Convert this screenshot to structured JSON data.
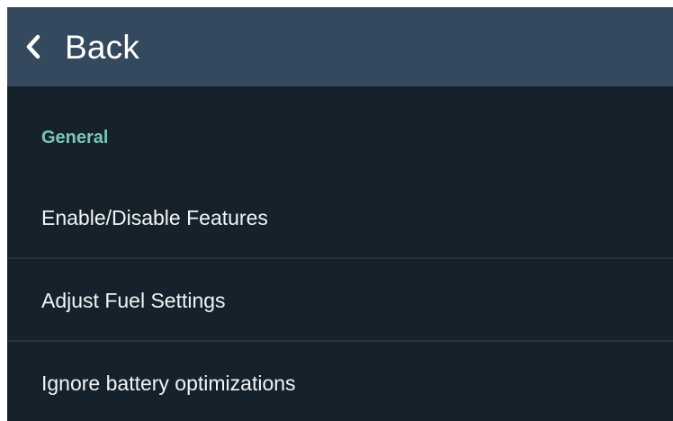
{
  "header": {
    "back_label": "Back",
    "back_icon": "chevron-left-icon"
  },
  "sections": [
    {
      "title": "General",
      "items": [
        {
          "label": "Enable/Disable Features"
        },
        {
          "label": "Adjust Fuel Settings"
        },
        {
          "label": "Ignore battery optimizations"
        }
      ]
    }
  ],
  "colors": {
    "toolbar": "#34495d",
    "background": "#16222b",
    "section_accent": "#7ec4b6",
    "item_text": "#f2f4f5",
    "divider": "#243440"
  }
}
